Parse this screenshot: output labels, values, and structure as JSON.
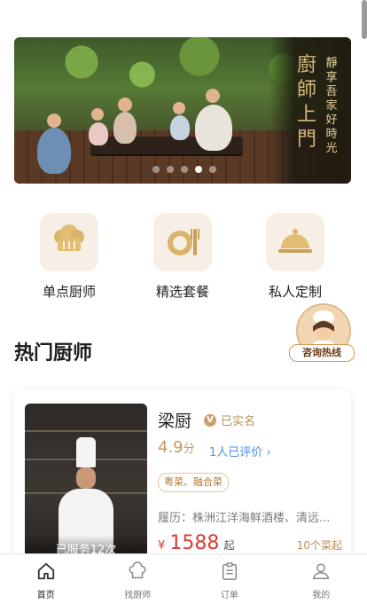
{
  "banner": {
    "title": "廚師上門",
    "subtitle": "靜享吾家好時光",
    "dots": 5,
    "active_dot": 4
  },
  "categories": [
    {
      "label": "单点厨师",
      "icon": "chef-hat-icon"
    },
    {
      "label": "精选套餐",
      "icon": "plate-fork-knife-icon"
    },
    {
      "label": "私人定制",
      "icon": "cloche-icon"
    }
  ],
  "consult": {
    "label": "咨询热线"
  },
  "section": {
    "title": "热门厨师"
  },
  "chef_card": {
    "name": "梁厨",
    "verified": "已实名",
    "verified_badge": "V",
    "score": "4.9",
    "score_unit": "分",
    "reviews": "1人已评价 ›",
    "tags": "粤菜、融合菜",
    "history": "履历：株洲江洋海鲜酒楼、清远...",
    "currency": "¥",
    "price": "1588",
    "price_suffix": "起",
    "dishes": "10个菜起",
    "served": "已服务12次"
  },
  "tabbar": [
    {
      "label": "首页",
      "icon": "home-icon",
      "active": true
    },
    {
      "label": "找厨师",
      "icon": "chef-hat-icon",
      "active": false
    },
    {
      "label": "订单",
      "icon": "clipboard-icon",
      "active": false
    },
    {
      "label": "我的",
      "icon": "user-icon",
      "active": false
    }
  ],
  "colors": {
    "accent": "#c69a5c",
    "price": "#d93b34",
    "link": "#4a8fe0",
    "tile_bg": "#f7efe6"
  }
}
